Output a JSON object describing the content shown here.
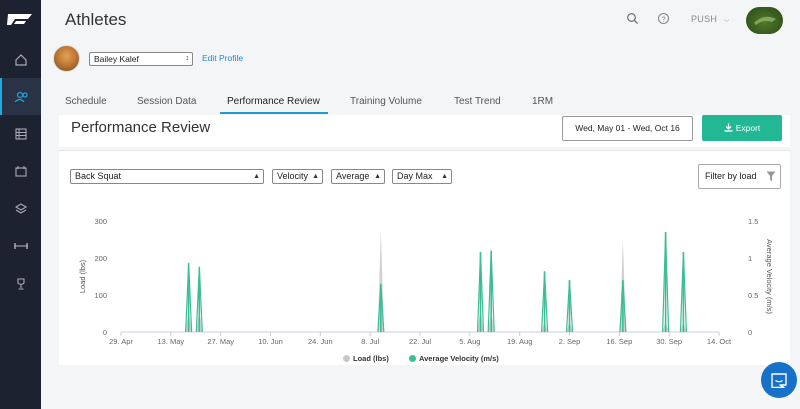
{
  "header": {
    "title": "Athletes",
    "org": "PUSH"
  },
  "athlete": {
    "name": "Bailey Kalef",
    "edit_label": "Edit Profile"
  },
  "tabs": [
    {
      "label": "Schedule"
    },
    {
      "label": "Session Data"
    },
    {
      "label": "Performance Review"
    },
    {
      "label": "Training Volume"
    },
    {
      "label": "Test Trend"
    },
    {
      "label": "1RM"
    }
  ],
  "panel": {
    "title": "Performance Review",
    "date_range": "Wed, May 01 - Wed, Oct 16",
    "export_label": "Export",
    "filter_label": "Filter by load",
    "exercise": "Back Squat",
    "metric": "Velocity",
    "aggregate": "Average",
    "grouping": "Day Max"
  },
  "colors": {
    "accent": "#22b893",
    "link": "#1e88d6",
    "tab_active": "#1e9ad6",
    "sidebar": "#1c2230",
    "load": "#c8c8c8",
    "velocity": "#3dbd96"
  },
  "chart_data": {
    "type": "line",
    "x_ticks": [
      "29. Apr",
      "13. May",
      "27. May",
      "10. Jun",
      "24. Jun",
      "8. Jul",
      "22. Jul",
      "5. Aug",
      "19. Aug",
      "2. Sep",
      "16. Sep",
      "30. Sep",
      "14. Oct"
    ],
    "ylabel_left": "Load (lbs)",
    "ylabel_right": "Average Velocity (m/s)",
    "y_left_ticks": [
      "0",
      "100",
      "200",
      "300"
    ],
    "y_right_ticks": [
      "0",
      "0.5",
      "1",
      "1.5"
    ],
    "ylim_left": [
      0,
      300
    ],
    "ylim_right": [
      0,
      1.5
    ],
    "x_range_days": [
      0,
      168
    ],
    "legend_position": "bottom",
    "series": [
      {
        "name": "Load (lbs)",
        "color": "#c8c8c8",
        "points": [
          {
            "x": "2019-05-18",
            "y": 60
          },
          {
            "x": "2019-05-21",
            "y": 60
          },
          {
            "x": "2019-07-11",
            "y": 277
          },
          {
            "x": "2019-08-08",
            "y": 60
          },
          {
            "x": "2019-08-11",
            "y": 60
          },
          {
            "x": "2019-08-26",
            "y": 30
          },
          {
            "x": "2019-09-02",
            "y": 30
          },
          {
            "x": "2019-09-17",
            "y": 250
          },
          {
            "x": "2019-09-29",
            "y": 30
          },
          {
            "x": "2019-10-04",
            "y": 30
          }
        ]
      },
      {
        "name": "Average Velocity (m/s)",
        "color": "#3dbd96",
        "points": [
          {
            "x": "2019-05-18",
            "y": 0.93
          },
          {
            "x": "2019-05-21",
            "y": 0.88
          },
          {
            "x": "2019-07-11",
            "y": 0.65
          },
          {
            "x": "2019-08-08",
            "y": 1.08
          },
          {
            "x": "2019-08-11",
            "y": 1.1
          },
          {
            "x": "2019-08-26",
            "y": 0.82
          },
          {
            "x": "2019-09-02",
            "y": 0.7
          },
          {
            "x": "2019-09-17",
            "y": 0.7
          },
          {
            "x": "2019-09-29",
            "y": 1.35
          },
          {
            "x": "2019-10-04",
            "y": 1.08
          }
        ]
      }
    ]
  }
}
